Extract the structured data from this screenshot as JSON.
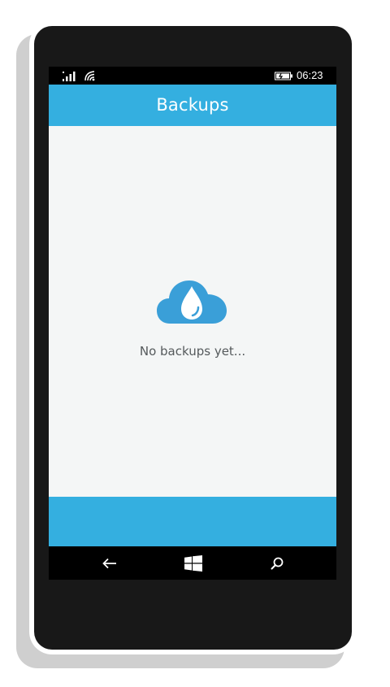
{
  "status_bar": {
    "time": "06:23",
    "icons": [
      "signal-icon",
      "wifi-icon",
      "battery-icon"
    ]
  },
  "header": {
    "title": "Backups"
  },
  "main": {
    "empty_icon": "cloud-drop-icon",
    "empty_message": "No backups yet..."
  },
  "nav": {
    "icons": [
      "back-arrow-icon",
      "windows-start-icon",
      "search-icon"
    ]
  },
  "colors": {
    "accent": "#34afe0",
    "icon": "#3a9fd8",
    "background": "#f4f6f6",
    "text": "#555a5c"
  }
}
